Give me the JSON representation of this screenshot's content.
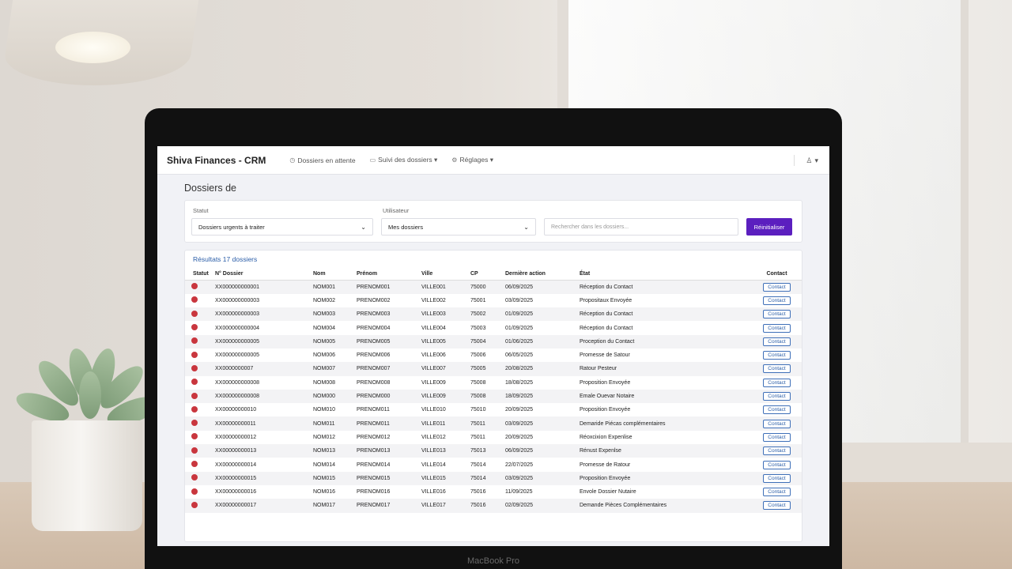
{
  "device": {
    "brand": "MacBook Pro"
  },
  "nav": {
    "app_title": "Shiva Finances - CRM",
    "items": [
      {
        "label": "Dossiers en attente",
        "icon": "folder-clock-icon"
      },
      {
        "label": "Suivi des dossiers ▾",
        "icon": "folder-icon"
      },
      {
        "label": "Réglages ▾",
        "icon": "gear-icon"
      }
    ],
    "user_menu": "▾"
  },
  "page": {
    "title": "Dossiers de"
  },
  "filters": {
    "statut_label": "Statut",
    "statut_value": "Dossiers urgents à traiter",
    "utilisateur_label": "Utilisateur",
    "utilisateur_value": "Mes dossiers",
    "search_placeholder": "Rechercher dans les dossiers...",
    "button_label": "Réinitialiser"
  },
  "results": {
    "title": "Résultats 17 dossiers",
    "columns": [
      "Statut",
      "N° Dossier",
      "Nom",
      "Prénom",
      "Ville",
      "CP",
      "Dernière action",
      "État",
      "Contact"
    ],
    "contact_label": "Contact",
    "status_color": "#c9363e",
    "rows": [
      {
        "num": "XX000000000001",
        "nom": "NOM001",
        "prenom": "PRENOM001",
        "ville": "VILLE001",
        "cp": "75000",
        "date": "06/09/2025",
        "etat": "Réception du Contact"
      },
      {
        "num": "XX000000000003",
        "nom": "NOM002",
        "prenom": "PRENOM002",
        "ville": "VILLE002",
        "cp": "75001",
        "date": "03/09/2025",
        "etat": "Propositaux Envoyée"
      },
      {
        "num": "XX000000000003",
        "nom": "NOM003",
        "prenom": "PRENOM003",
        "ville": "VILLE003",
        "cp": "75002",
        "date": "01/09/2025",
        "etat": "Réception du Contact"
      },
      {
        "num": "XX000000000004",
        "nom": "NOM004",
        "prenom": "PRENOM004",
        "ville": "VILLE004",
        "cp": "75003",
        "date": "01/09/2025",
        "etat": "Réception du Contact"
      },
      {
        "num": "XX000000000005",
        "nom": "NOM005",
        "prenom": "PRENOM005",
        "ville": "VILLE005",
        "cp": "75004",
        "date": "01/06/2025",
        "etat": "Proception du Contact"
      },
      {
        "num": "XX000000000005",
        "nom": "NOM006",
        "prenom": "PRENOM006",
        "ville": "VILLE006",
        "cp": "75006",
        "date": "06/05/2025",
        "etat": "Promesse de Satour"
      },
      {
        "num": "XX0000000007",
        "nom": "NOM007",
        "prenom": "PRENOM007",
        "ville": "VILLE007",
        "cp": "75005",
        "date": "20/08/2025",
        "etat": "Ratour Pesteur"
      },
      {
        "num": "XX000000000008",
        "nom": "NOM008",
        "prenom": "PRENOM008",
        "ville": "VILLE009",
        "cp": "75008",
        "date": "18/08/2025",
        "etat": "Proposition Envoyée"
      },
      {
        "num": "XX000000000008",
        "nom": "NOM000",
        "prenom": "PRENOM000",
        "ville": "VILLE009",
        "cp": "75008",
        "date": "18/09/2025",
        "etat": "Emale Ouevar Notaire"
      },
      {
        "num": "XX00000000010",
        "nom": "NOM010",
        "prenom": "PRENOM011",
        "ville": "VILLE010",
        "cp": "75010",
        "date": "20/09/2025",
        "etat": "Proposition Envoyée"
      },
      {
        "num": "XX00000000011",
        "nom": "NOM011",
        "prenom": "PRENOM011",
        "ville": "VILLE011",
        "cp": "75011",
        "date": "03/09/2025",
        "etat": "Demaride Piécas complémentaires"
      },
      {
        "num": "XX00000000012",
        "nom": "NOM012",
        "prenom": "PRENOM012",
        "ville": "VILLE012",
        "cp": "75011",
        "date": "20/09/2025",
        "etat": "Réoxcixion Expenlise"
      },
      {
        "num": "XX00000000013",
        "nom": "NOM013",
        "prenom": "PRENOM013",
        "ville": "VILLE013",
        "cp": "75013",
        "date": "06/09/2025",
        "etat": "Rénust Expenlse"
      },
      {
        "num": "XX00000000014",
        "nom": "NOM014",
        "prenom": "PRENOM014",
        "ville": "VILLE014",
        "cp": "75014",
        "date": "22/07/2025",
        "etat": "Promesse de Ratour"
      },
      {
        "num": "XX00000000015",
        "nom": "NOM015",
        "prenom": "PRENOM015",
        "ville": "VILLE015",
        "cp": "75014",
        "date": "03/09/2025",
        "etat": "Proposition Envoyée"
      },
      {
        "num": "XX00000000016",
        "nom": "NOM016",
        "prenom": "PRENOM016",
        "ville": "VILLE016",
        "cp": "75016",
        "date": "11/09/2025",
        "etat": "Envole Dossier Nutaire"
      },
      {
        "num": "XX00000000017",
        "nom": "NOM017",
        "prenom": "PRENOM017",
        "ville": "VILLE017",
        "cp": "75016",
        "date": "02/09/2025",
        "etat": "Demande Pièces Complémentaires"
      }
    ]
  }
}
